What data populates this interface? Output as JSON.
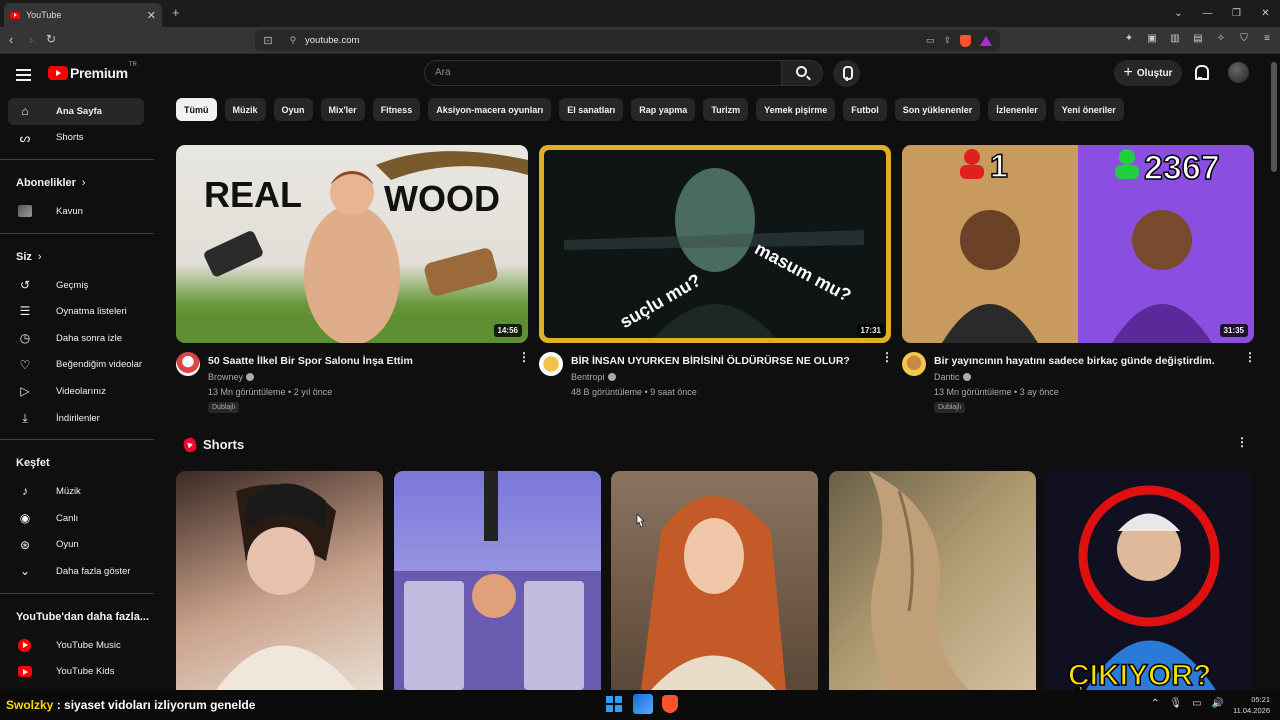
{
  "browser": {
    "tab_title": "YouTube",
    "tab_close": "✕",
    "new_tab": "+",
    "url": "youtube.com",
    "window_controls": [
      "⌄",
      "—",
      "❐",
      "✕"
    ]
  },
  "header": {
    "logo_text": "Premium",
    "country": "TR",
    "search_placeholder": "Ara",
    "create_label": "Oluştur"
  },
  "sidebar": {
    "top": [
      {
        "label": "Ana Sayfa",
        "icon": "home-icon"
      },
      {
        "label": "Shorts",
        "icon": "shorts-icon"
      }
    ],
    "subscriptions_title": "Abonelikler",
    "subscriptions": [
      {
        "label": "Kavun"
      }
    ],
    "you_title": "Siz",
    "you_items": [
      {
        "label": "Geçmiş",
        "icon": "history-icon"
      },
      {
        "label": "Oynatma listeleri",
        "icon": "playlists-icon"
      },
      {
        "label": "Daha sonra izle",
        "icon": "watch-later-icon"
      },
      {
        "label": "Beğendiğim videolar",
        "icon": "like-icon"
      },
      {
        "label": "Videolarınız",
        "icon": "your-videos-icon"
      },
      {
        "label": "İndirilenler",
        "icon": "download-icon"
      }
    ],
    "explore_title": "Keşfet",
    "explore_items": [
      {
        "label": "Müzik",
        "icon": "music-icon"
      },
      {
        "label": "Canlı",
        "icon": "live-icon"
      },
      {
        "label": "Oyun",
        "icon": "gaming-icon"
      },
      {
        "label": "Daha fazla göster",
        "icon": "chevron-down-icon"
      }
    ],
    "more_title": "YouTube'dan daha fazla...",
    "more_items": [
      {
        "label": "YouTube Music"
      },
      {
        "label": "YouTube Kids"
      }
    ]
  },
  "chips": [
    "Tümü",
    "Müzik",
    "Oyun",
    "Mix'ler",
    "Fitness",
    "Aksiyon-macera oyunları",
    "El sanatları",
    "Rap yapma",
    "Turizm",
    "Yemek pişirme",
    "Futbol",
    "Son yüklenenler",
    "İzlenenler",
    "Yeni öneriler"
  ],
  "videos": [
    {
      "title": "50 Saatte İlkel Bir Spor Salonu İnşa Ettim",
      "channel": "Browney",
      "stats": "13 Mn görüntüleme • 2 yıl önce",
      "badge": "Dublajlı",
      "duration": "14:56",
      "thumb_text_left": "REAL",
      "thumb_text_right": "WOOD"
    },
    {
      "title": "BİR İNSAN UYURKEN BİRİSİNİ ÖLDÜRÜRSE NE OLUR?",
      "channel": "Bentropi",
      "stats": "48 B görüntüleme • 9 saat önce",
      "badge": "",
      "duration": "17:31",
      "thumb_text_left": "suçlu mu?",
      "thumb_text_right": "masum mu?"
    },
    {
      "title": "Bir yayıncının hayatını sadece birkaç günde değiştirdim.",
      "channel": "Dantic",
      "stats": "13 Mn görüntüleme • 3 ay önce",
      "badge": "Dublajlı",
      "duration": "31:35",
      "thumb_text_left": "1",
      "thumb_text_right": "2367"
    }
  ],
  "shorts": {
    "title": "Shorts",
    "last_thumb_text": "ÇIKIYOR?"
  },
  "overlay": {
    "chat_user": "Swolzky",
    "chat_message": " : siyaset vidoları izliyorum genelde"
  },
  "taskbar": {
    "time": "05:21",
    "date": "11.04.2026"
  },
  "colors": {
    "accent": "#ff0000",
    "background": "#0f0f0f",
    "chip": "#272727"
  }
}
